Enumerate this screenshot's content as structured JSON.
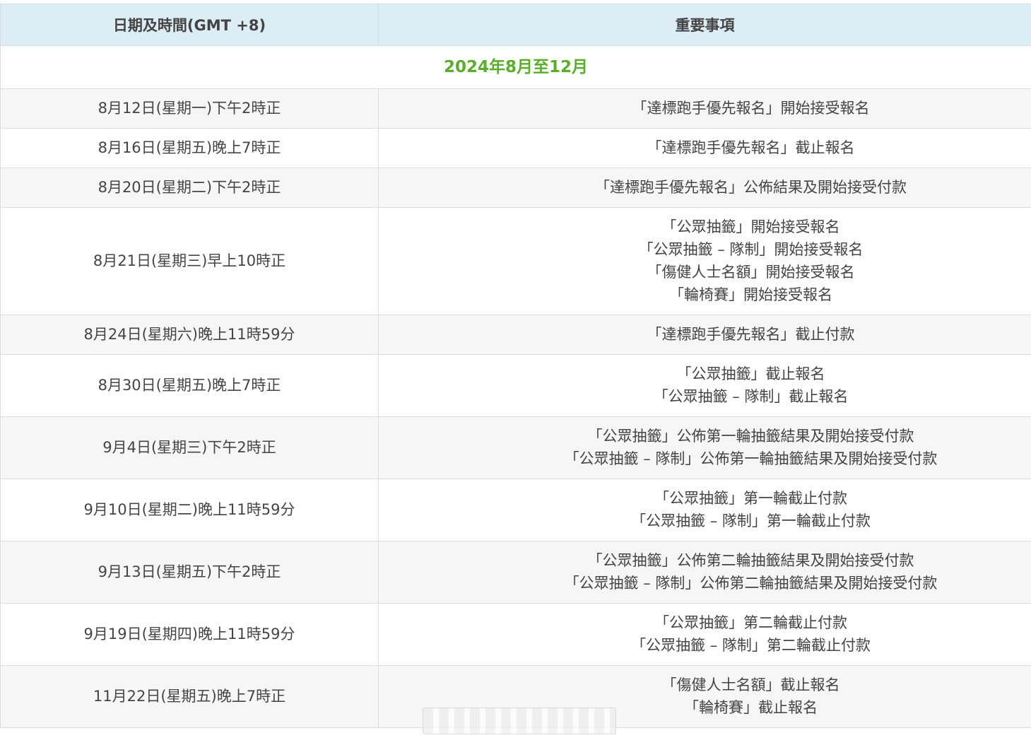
{
  "table": {
    "headers": {
      "date": "日期及時間(GMT +8)",
      "event": "重要事項"
    },
    "period": "2024年8月至12月",
    "rows": [
      {
        "date": "8月12日(星期一)下午2時正",
        "events": [
          "「達標跑手優先報名」開始接受報名"
        ]
      },
      {
        "date": "8月16日(星期五)晚上7時正",
        "events": [
          "「達標跑手優先報名」截止報名"
        ]
      },
      {
        "date": "8月20日(星期二)下午2時正",
        "events": [
          "「達標跑手優先報名」公佈結果及開始接受付款"
        ]
      },
      {
        "date": "8月21日(星期三)早上10時正",
        "events": [
          "「公眾抽籤」開始接受報名",
          "「公眾抽籤 – 隊制」開始接受報名",
          "「傷健人士名額」開始接受報名",
          "「輪椅賽」開始接受報名"
        ]
      },
      {
        "date": "8月24日(星期六)晚上11時59分",
        "events": [
          "「達標跑手優先報名」截止付款"
        ]
      },
      {
        "date": "8月30日(星期五)晚上7時正",
        "events": [
          "「公眾抽籤」截止報名",
          "「公眾抽籤 – 隊制」截止報名"
        ]
      },
      {
        "date": "9月4日(星期三)下午2時正",
        "events": [
          "「公眾抽籤」公佈第一輪抽籤結果及開始接受付款",
          "「公眾抽籤 – 隊制」公佈第一輪抽籤結果及開始接受付款"
        ]
      },
      {
        "date": "9月10日(星期二)晚上11時59分",
        "events": [
          "「公眾抽籤」第一輪截止付款",
          "「公眾抽籤 – 隊制」第一輪截止付款"
        ]
      },
      {
        "date": "9月13日(星期五)下午2時正",
        "events": [
          "「公眾抽籤」公佈第二輪抽籤結果及開始接受付款",
          "「公眾抽籤 – 隊制」公佈第二輪抽籤結果及開始接受付款"
        ]
      },
      {
        "date": "9月19日(星期四)晚上11時59分",
        "events": [
          "「公眾抽籤」第二輪截止付款",
          "「公眾抽籤 – 隊制」第二輪截止付款"
        ]
      },
      {
        "date": "11月22日(星期五)晚上7時正",
        "events": [
          "「傷健人士名額」截止報名",
          "「輪椅賽」截止報名"
        ]
      }
    ]
  },
  "colors": {
    "header_bg": "#dcedf5",
    "period_text": "#5aae2a",
    "row_alt_bg": "#f6f6f6",
    "text": "#444444"
  }
}
